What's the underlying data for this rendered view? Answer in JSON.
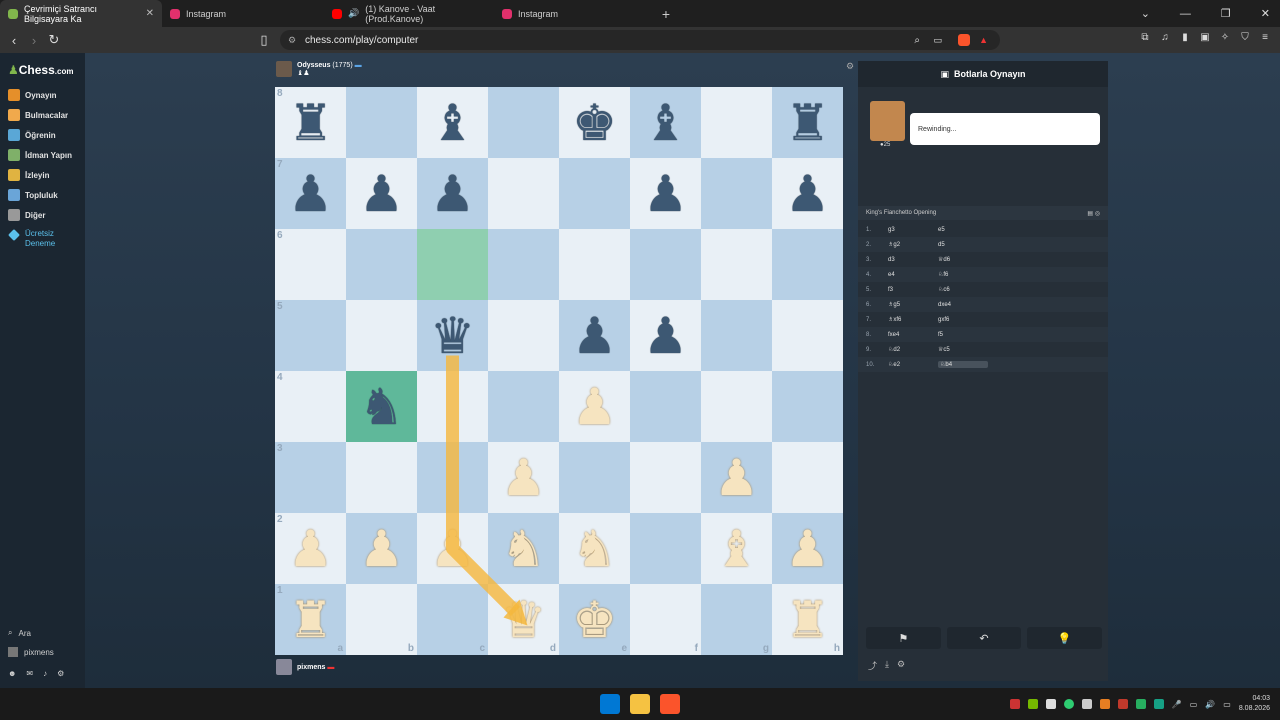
{
  "browser": {
    "tabs": [
      {
        "title": "Çevrimiçi Satrancı Bilgisayara Ka",
        "favicon_color": "#81b64c",
        "active": true
      },
      {
        "title": "Instagram",
        "favicon_color": "#e1306c",
        "active": false
      },
      {
        "title": "(1) Kanove - Vaat (Prod.Kanove)",
        "favicon_color": "#ff0000",
        "active": false
      },
      {
        "title": "Instagram",
        "favicon_color": "#e1306c",
        "active": false
      }
    ],
    "tab_close": "✕",
    "new_tab": "+",
    "url": "chess.com/play/computer",
    "window_controls": [
      "⌄",
      "—",
      "❐",
      "✕"
    ]
  },
  "sidebar": {
    "logo": "Chess",
    "logo_suffix": ".com",
    "items": [
      {
        "label": "Oynayın",
        "color": "#e58f2a"
      },
      {
        "label": "Bulmacalar",
        "color": "#f0a94c"
      },
      {
        "label": "Öğrenin",
        "color": "#5aa7d6"
      },
      {
        "label": "İdman Yapın",
        "color": "#7fb069"
      },
      {
        "label": "İzleyin",
        "color": "#e0b341"
      },
      {
        "label": "Topluluk",
        "color": "#6aa5d8"
      },
      {
        "label": "Diğer",
        "color": "#999999"
      }
    ],
    "trial_line1": "Ücretsiz",
    "trial_line2": "Deneme",
    "search": "Ara",
    "username": "pixmens"
  },
  "top_player": {
    "name": "Odysseus",
    "rating": "(1775)"
  },
  "bottom_player": {
    "name": "pixmens"
  },
  "board": {
    "ranks": [
      "8",
      "7",
      "6",
      "5",
      "4",
      "3",
      "2",
      "1"
    ],
    "files": [
      "a",
      "b",
      "c",
      "d",
      "e",
      "f",
      "g",
      "h"
    ],
    "position": [
      [
        "br",
        "",
        "bb",
        "",
        "bk",
        "bb",
        "",
        "br"
      ],
      [
        "bp",
        "bp",
        "bp",
        "",
        "",
        "bp",
        "",
        "bp"
      ],
      [
        "",
        "",
        "",
        "",
        "",
        "",
        "",
        ""
      ],
      [
        "",
        "",
        "bq",
        "",
        "bp",
        "bp",
        "",
        ""
      ],
      [
        "",
        "bn",
        "",
        "",
        "wp",
        "",
        "",
        ""
      ],
      [
        "",
        "",
        "",
        "wp",
        "",
        "",
        "wp",
        ""
      ],
      [
        "wp",
        "wp",
        "wp",
        "wn",
        "wn",
        "",
        "wb",
        "wp"
      ],
      [
        "wr",
        "",
        "",
        "wq",
        "wk",
        "",
        "",
        "wr"
      ]
    ],
    "highlights": [
      {
        "square": "c6",
        "tone": "light"
      },
      {
        "square": "b4",
        "tone": "dark"
      }
    ],
    "arrow_color": "#f5b73c"
  },
  "panel": {
    "title": "Botlarla Oynayın",
    "bubble": "Rewinding...",
    "bot_rating": "25",
    "opening": "King's Fianchetto Opening",
    "moves": [
      {
        "n": "1.",
        "w": "g3",
        "b": "e5"
      },
      {
        "n": "2.",
        "w": "♗g2",
        "b": "d5"
      },
      {
        "n": "3.",
        "w": "d3",
        "b": "♕d6"
      },
      {
        "n": "4.",
        "w": "e4",
        "b": "♘f6"
      },
      {
        "n": "5.",
        "w": "f3",
        "b": "♘c6"
      },
      {
        "n": "6.",
        "w": "♗g5",
        "b": "dxe4"
      },
      {
        "n": "7.",
        "w": "♗xf6",
        "b": "gxf6"
      },
      {
        "n": "8.",
        "w": "fxe4",
        "b": "f5"
      },
      {
        "n": "9.",
        "w": "♘d2",
        "b": "♕c5"
      },
      {
        "n": "10.",
        "w": "♘e2",
        "b": "♘b4"
      }
    ],
    "actions": [
      "⚑",
      "↶",
      "💡"
    ]
  },
  "taskbar": {
    "time": "04:03",
    "date": "8.08.2026",
    "icons": [
      "#0078d4",
      "#f5c242",
      "#fb542b"
    ]
  }
}
